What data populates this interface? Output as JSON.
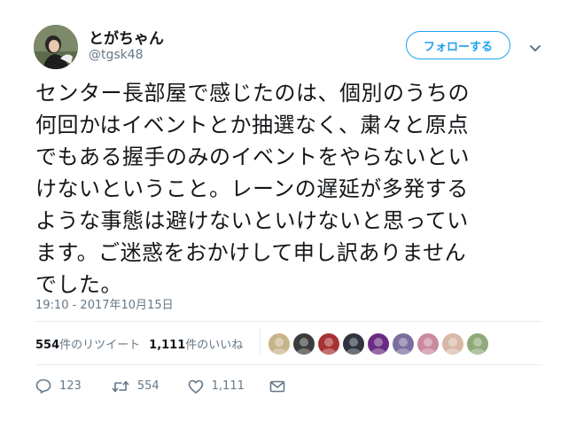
{
  "user": {
    "display_name": "とがちゃん",
    "screen_name": "@tgsk48"
  },
  "follow_label": "フォローする",
  "tweet": {
    "text": "センター長部屋で感じたのは、個別のうちの\n何回かはイベントとか抽選なく、粛々と原点\nでもある握手のみのイベントをやらないとい\nけないということ。レーンの遅延が多発する\nような事態は避けないといけないと思ってい\nます。ご迷惑をおかけして申し訳ありません\nでした。",
    "timestamp": "19:10 - 2017年10月15日"
  },
  "stats": {
    "retweets_count": "554",
    "retweets_label": "件のリツイート",
    "likes_count": "1,111",
    "likes_label": "件のいいね"
  },
  "likers": [
    {
      "icon": "avatar-cartoon",
      "color": "#c9b48a"
    },
    {
      "icon": "avatar-gorilla",
      "color": "#3c3c3c"
    },
    {
      "icon": "avatar-anime",
      "color": "#a83232"
    },
    {
      "icon": "avatar-dark",
      "color": "#2e3440"
    },
    {
      "icon": "avatar-purple",
      "color": "#6a2c82"
    },
    {
      "icon": "avatar-girls",
      "color": "#7a6e9e"
    },
    {
      "icon": "avatar-pink",
      "color": "#c98aa0"
    },
    {
      "icon": "avatar-woman",
      "color": "#d9b8a8"
    },
    {
      "icon": "avatar-group",
      "color": "#8fa97a"
    }
  ],
  "actions": {
    "reply_count": "123",
    "retweet_count": "554",
    "like_count": "1,111"
  },
  "colors": {
    "accent": "#1da1f2",
    "text": "#14171a",
    "muted": "#657786",
    "divider": "#e6ecf0"
  }
}
